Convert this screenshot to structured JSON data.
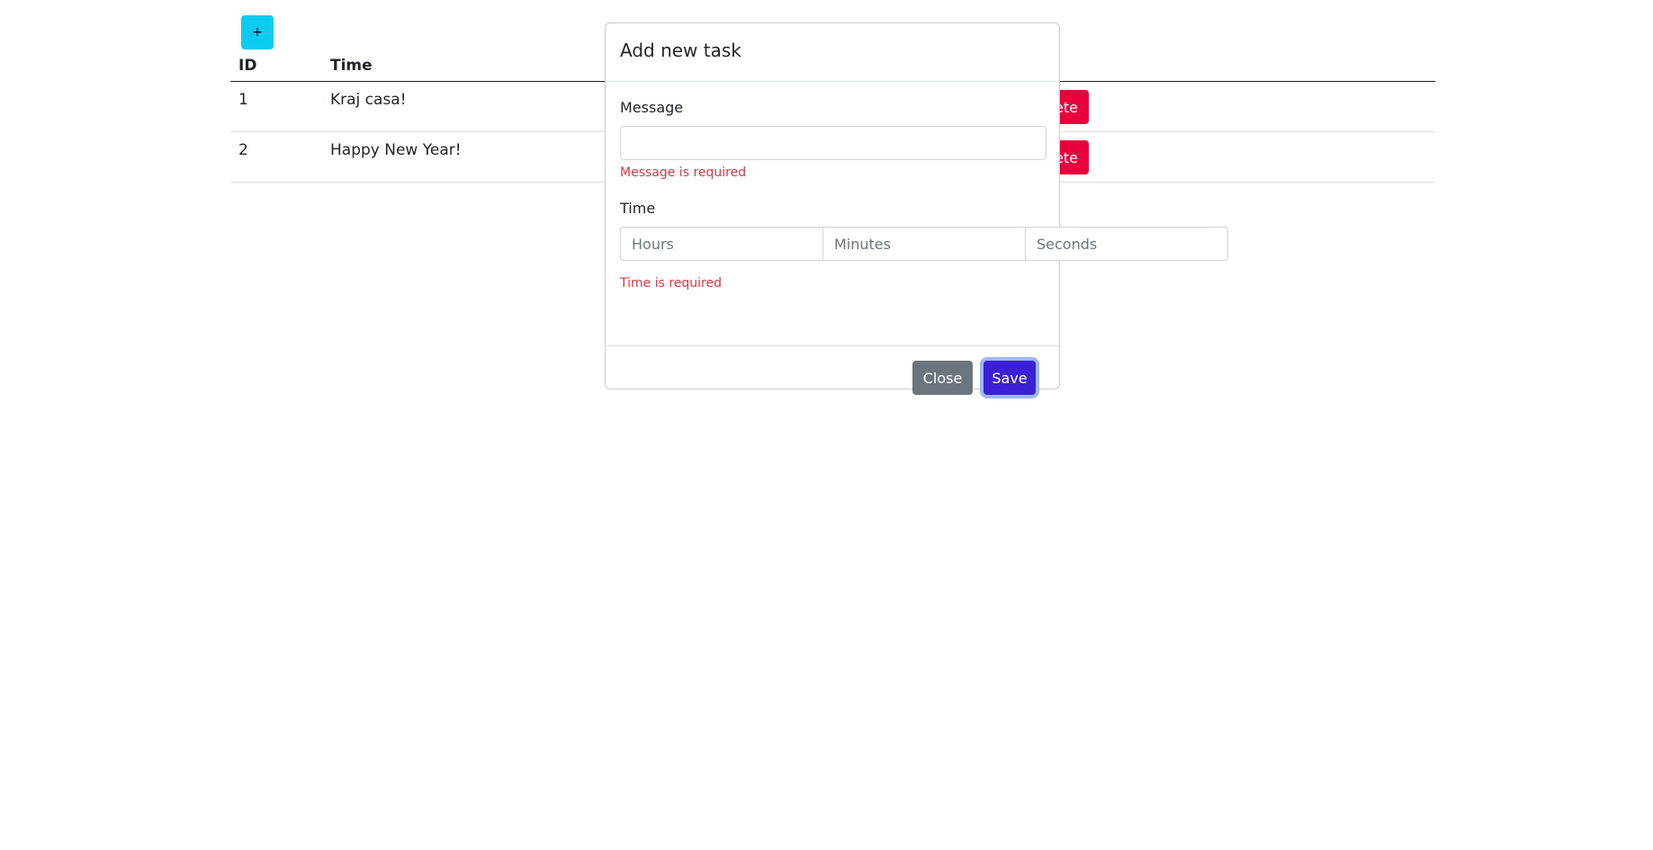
{
  "toolbar": {
    "add_label": "+"
  },
  "table": {
    "headers": {
      "id": "ID",
      "time": "Time"
    },
    "rows": [
      {
        "id": "1",
        "message": "Kraj casa!",
        "delete_label": "ete"
      },
      {
        "id": "2",
        "message": "Happy New Year!",
        "delete_label": "ete"
      }
    ]
  },
  "modal": {
    "title": "Add new task",
    "message_label": "Message",
    "message_value": "",
    "message_error": "Message is required",
    "time_label": "Time",
    "hours_placeholder": "Hours",
    "minutes_placeholder": "Minutes",
    "seconds_placeholder": "Seconds",
    "time_error": "Time is required",
    "close_label": "Close",
    "save_label": "Save"
  },
  "colors": {
    "add_button": "#0dcaf0",
    "delete_button": "#e8003d",
    "error_text": "#dc3545",
    "close_button": "#6c757d",
    "save_button": "#3d1fd6"
  }
}
